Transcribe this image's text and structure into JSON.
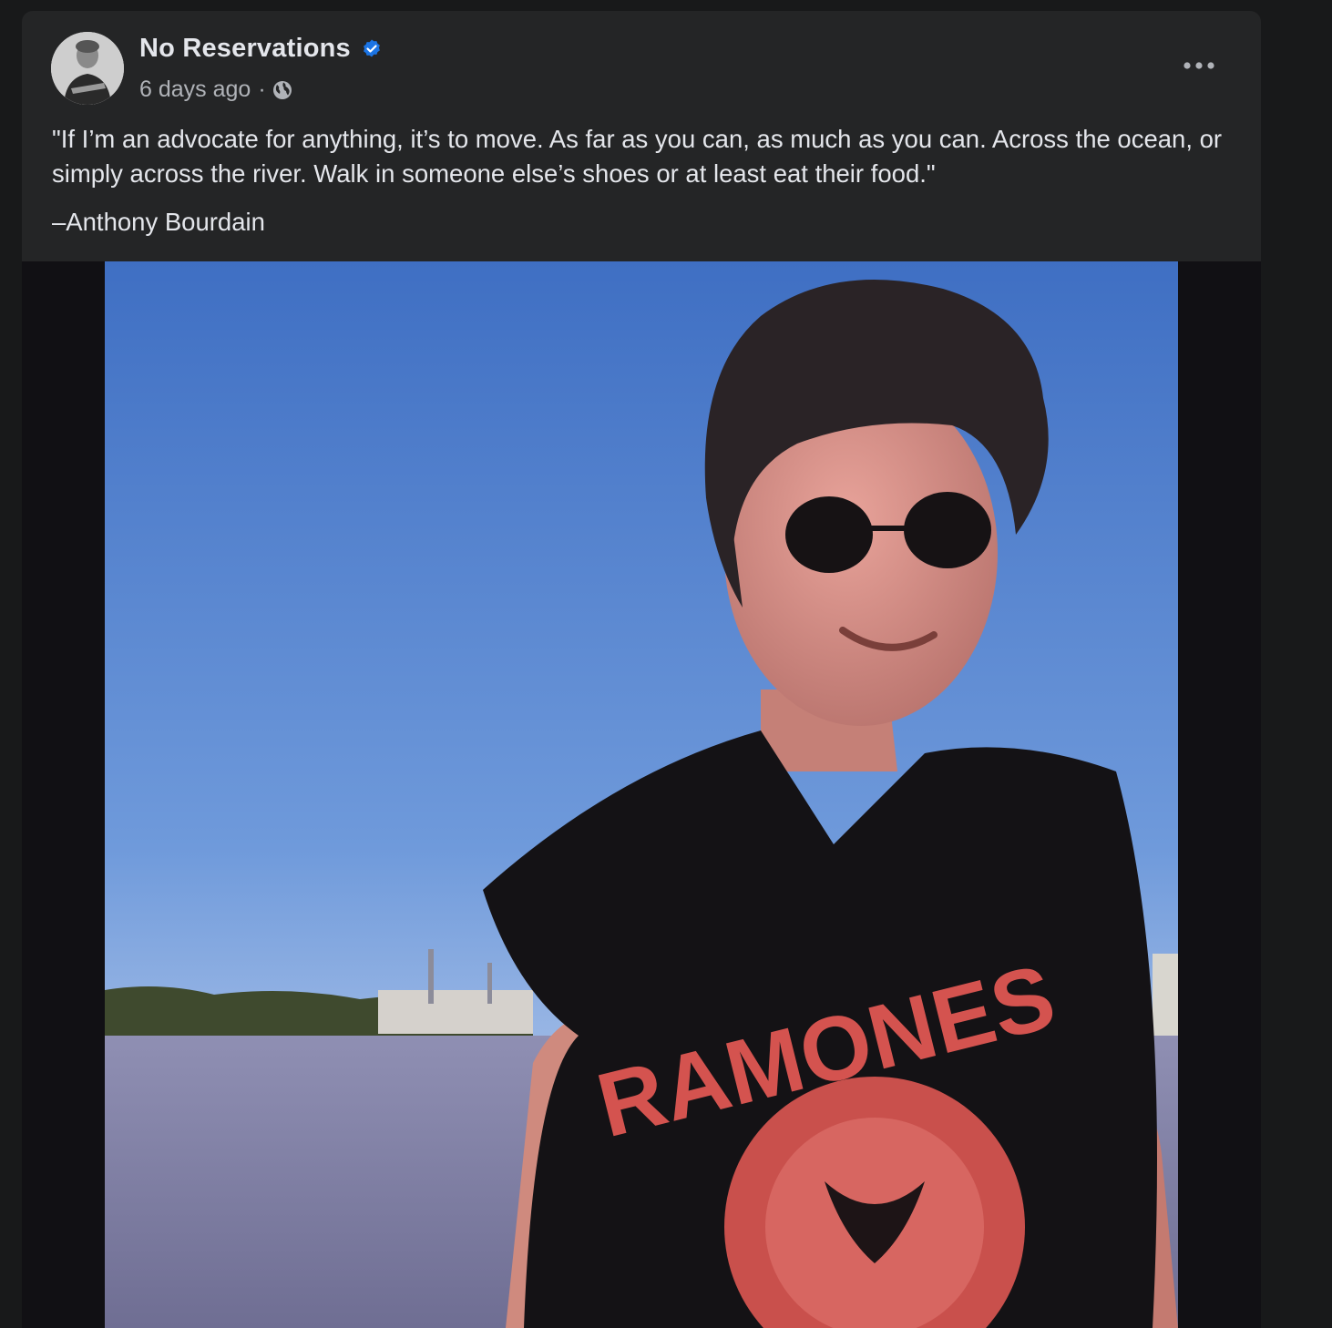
{
  "post": {
    "author": "No Reservations",
    "timestamp": "6 days ago",
    "separator": "·",
    "text": "\"If I’m an advocate for anything, it’s to move. As far as you can, as much as you can. Across the ocean, or simply across the river. Walk in someone else’s shoes or at least eat their food.\"",
    "attribution": "–Anthony Bourdain"
  },
  "icons": {
    "verified": "verified-badge-icon",
    "audience": "globe-icon",
    "more": "more-options-icon"
  },
  "colors": {
    "card_bg": "#242526",
    "page_bg": "#18191a",
    "primary_text": "#e4e6eb",
    "secondary_text": "#b0b3b8",
    "verified_blue": "#1b74e4"
  },
  "photo": {
    "shirt_text": "RAMONES"
  }
}
